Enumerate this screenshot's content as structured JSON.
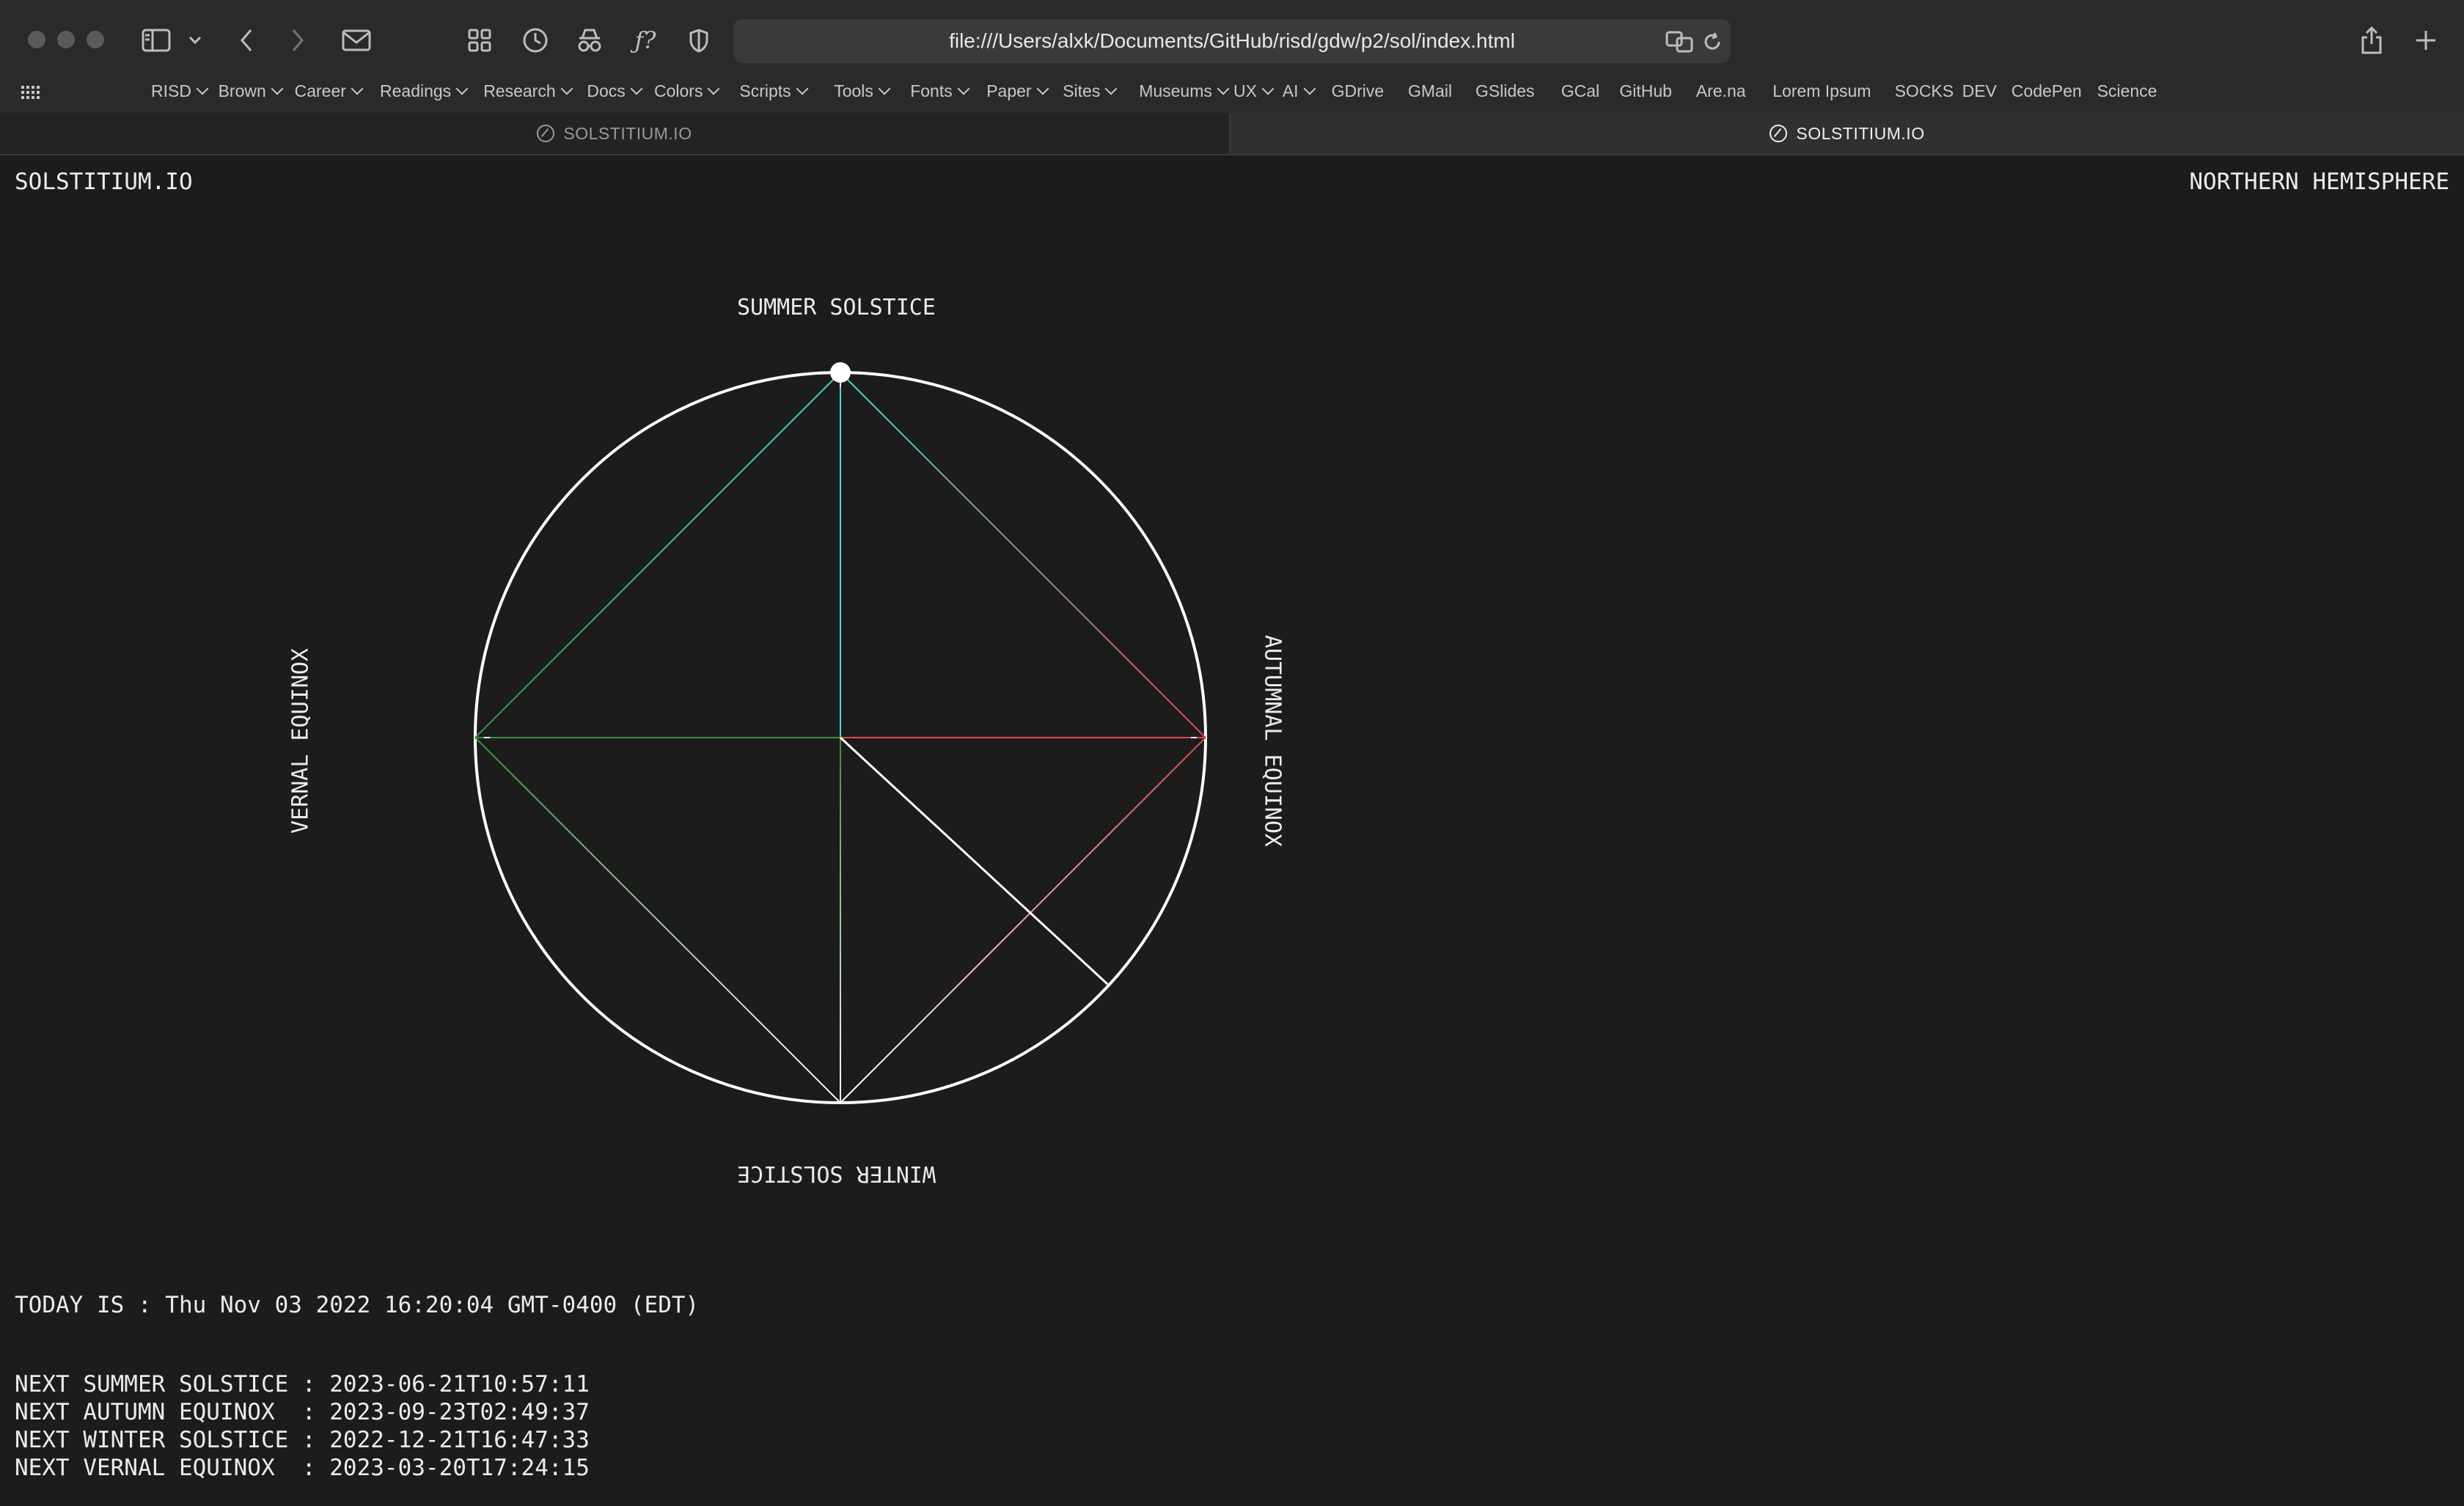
{
  "browser": {
    "url": "file:///Users/alxk/Documents/GitHub/risd/gdw/p2/sol/index.html",
    "bookmarks": [
      {
        "label": "RISD",
        "menu": true
      },
      {
        "label": "Brown",
        "menu": true
      },
      {
        "label": "Career",
        "menu": true
      },
      {
        "label": "Readings",
        "menu": true
      },
      {
        "label": "Research",
        "menu": true
      },
      {
        "label": "Docs",
        "menu": true
      },
      {
        "label": "Colors",
        "menu": true
      },
      {
        "label": "Scripts",
        "menu": true
      },
      {
        "label": "Tools",
        "menu": true
      },
      {
        "label": "Fonts",
        "menu": true
      },
      {
        "label": "Paper",
        "menu": true
      },
      {
        "label": "Sites",
        "menu": true
      },
      {
        "label": "Museums",
        "menu": true
      },
      {
        "label": "UX",
        "menu": true
      },
      {
        "label": "AI",
        "menu": true
      },
      {
        "label": "GDrive",
        "menu": false
      },
      {
        "label": "GMail",
        "menu": false
      },
      {
        "label": "GSlides",
        "menu": false
      },
      {
        "label": "GCal",
        "menu": false
      },
      {
        "label": "GitHub",
        "menu": false
      },
      {
        "label": "Are.na",
        "menu": false
      },
      {
        "label": "Lorem Ipsum",
        "menu": false
      },
      {
        "label": "SOCKS",
        "menu": false
      },
      {
        "label": "DEV",
        "menu": false
      },
      {
        "label": "CodePen",
        "menu": false
      },
      {
        "label": "Science",
        "menu": false
      }
    ],
    "tabs": [
      {
        "label": "SOLSTITIUM.IO",
        "active": false
      },
      {
        "label": "SOLSTITIUM.IO",
        "active": true
      }
    ]
  },
  "page": {
    "site_title": "SOLSTITIUM.IO",
    "hemisphere": "NORTHERN HEMISPHERE",
    "labels": {
      "summer": "SUMMER SOLSTICE",
      "winter": "WINTER SOLSTICE",
      "vernal": "VERNAL EQUINOX",
      "autumn": "AUTUMNAL EQUINOX"
    },
    "today": "TODAY IS : Thu Nov 03 2022 16:20:04 GMT-0400 (EDT)",
    "events": [
      "NEXT SUMMER SOLSTICE : 2023-06-21T10:57:11",
      "NEXT AUTUMN EQUINOX  : 2023-09-23T02:49:37",
      "NEXT WINTER SOLSTICE : 2022-12-21T16:47:33",
      "NEXT VERNAL EQUINOX  : 2023-03-20T17:24:15"
    ],
    "colors": {
      "background": "#1c1c1c",
      "summer_line": "#4fd6d6",
      "vernal_line": "#3f8f3f",
      "autumn_line": "#d94b4b",
      "winter_line": "#ffffff",
      "current_marker": "#ffffff"
    }
  }
}
